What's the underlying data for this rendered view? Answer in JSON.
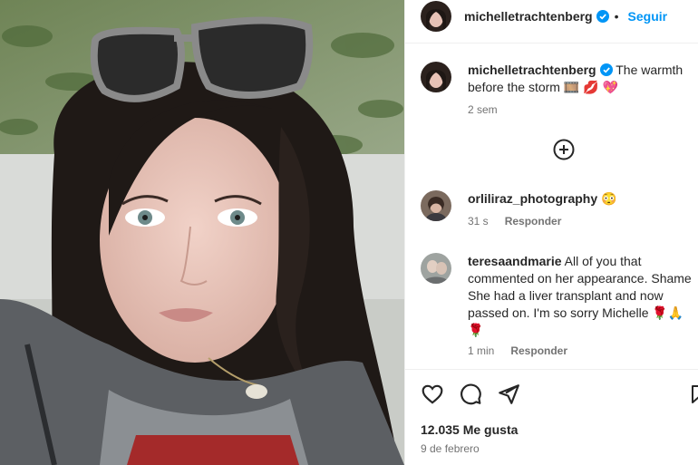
{
  "post": {
    "username": "michelletrachtenberg",
    "follow_label": "Seguir"
  },
  "caption": {
    "username": "michelletrachtenberg",
    "text": "The warmth before the storm",
    "emojis": "🎞️ 💋 💖",
    "time": "2 sem"
  },
  "comments": [
    {
      "username": "orliliraz_photography",
      "text": "😳",
      "time": "31 s",
      "reply_label": "Responder"
    },
    {
      "username": "teresaandmarie",
      "text": "All of you that commented on her appearance. Shame She had a liver transplant and now passed on. I'm so sorry Michelle 🌹🙏 🌹",
      "time": "1 min",
      "reply_label": "Responder"
    }
  ],
  "likes": "12.035 Me gusta",
  "date": "9 de febrero",
  "icons": {
    "verified": "verified-badge-icon",
    "more_comments": "plus-circle-icon",
    "like": "heart-icon",
    "comment": "comment-icon",
    "share": "send-icon",
    "save": "bookmark-icon"
  },
  "colors": {
    "accent": "#0095f6",
    "text": "#262626",
    "muted": "#737373"
  }
}
